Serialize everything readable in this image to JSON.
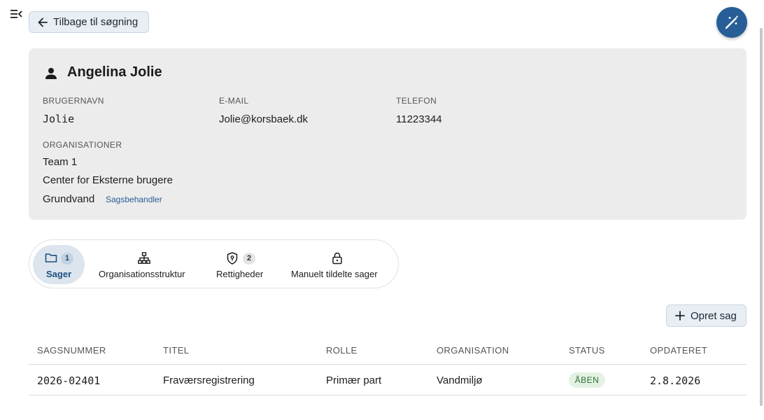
{
  "header": {
    "back_label": "Tilbage til søgning",
    "menu_icon": "menu-collapse-icon",
    "magic_icon": "magic-wand-icon"
  },
  "user": {
    "name": "Angelina Jolie",
    "username_label": "BRUGERNAVN",
    "username": "Jolie",
    "email_label": "E-MAIL",
    "email": "Jolie@korsbaek.dk",
    "phone_label": "TELEFON",
    "phone": "11223344",
    "orgs_label": "ORGANISATIONER",
    "orgs": [
      {
        "name": "Team 1",
        "role": ""
      },
      {
        "name": "Center for Eksterne brugere",
        "role": ""
      },
      {
        "name": "Grundvand",
        "role": "Sagsbehandler"
      }
    ]
  },
  "tabs": [
    {
      "label": "Sager",
      "badge": "1",
      "icon": "folder-icon",
      "active": true
    },
    {
      "label": "Organisationsstruktur",
      "badge": "",
      "icon": "org-chart-icon",
      "active": false
    },
    {
      "label": "Rettigheder",
      "badge": "2",
      "icon": "shield-icon",
      "active": false
    },
    {
      "label": "Manuelt tildelte sager",
      "badge": "",
      "icon": "lock-icon",
      "active": false
    }
  ],
  "actions": {
    "create_label": "Opret sag"
  },
  "table": {
    "columns": [
      "SAGSNUMMER",
      "TITEL",
      "ROLLE",
      "ORGANISATION",
      "STATUS",
      "OPDATERET"
    ],
    "rows": [
      {
        "case_number": "2026-02401",
        "title": "Fraværsregistrering",
        "role": "Primær part",
        "organisation": "Vandmiljø",
        "status": "ÅBEN",
        "updated": "2.8.2026"
      }
    ]
  },
  "colors": {
    "accent": "#275e97",
    "status_open_bg": "#e3f2e3",
    "status_open_text": "#2e6e35"
  }
}
